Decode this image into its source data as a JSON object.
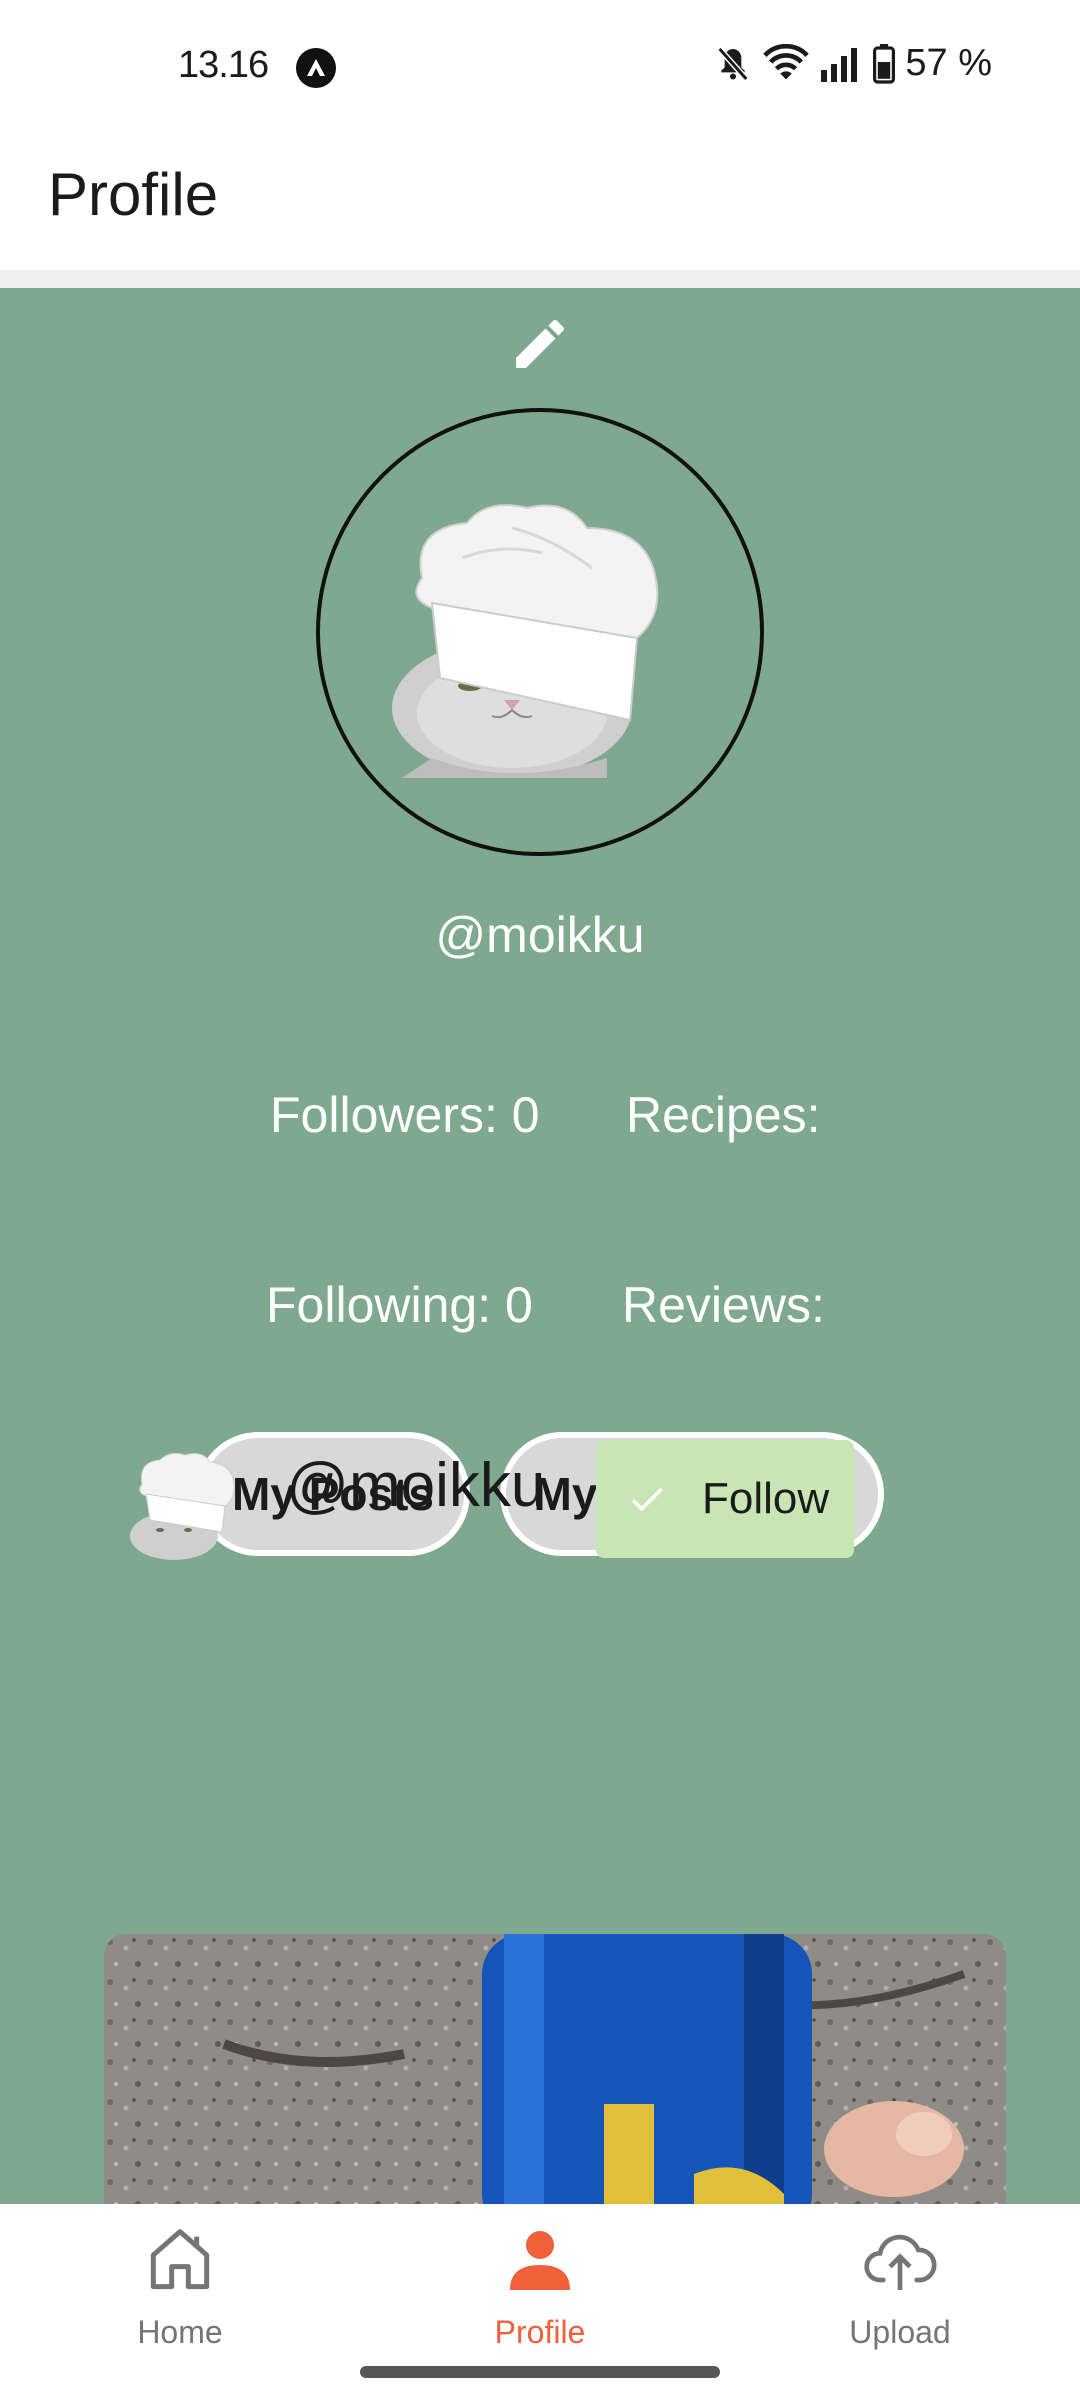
{
  "status_bar": {
    "time": "13.16",
    "battery": "57 %"
  },
  "appbar": {
    "title": "Profile"
  },
  "profile": {
    "handle": "@moikku",
    "stats": {
      "followers": "Followers: 0",
      "recipes": "Recipes:",
      "following": "Following: 0",
      "reviews": "Reviews:"
    },
    "buttons": {
      "my_posts": "My Posts",
      "my_liked_posts": "My liked posts"
    }
  },
  "post": {
    "author": "@moikku",
    "follow_label": "Follow"
  },
  "bottom_nav": {
    "items": [
      {
        "label": "Home",
        "icon": "home-icon"
      },
      {
        "label": "Profile",
        "icon": "person-icon",
        "active": true
      },
      {
        "label": "Upload",
        "icon": "cloud-upload-icon"
      }
    ],
    "active_color": "#f0603a",
    "inactive_color": "#757575"
  },
  "colors": {
    "background": "#7ea98e",
    "follow_button": "#c8e6b4"
  }
}
